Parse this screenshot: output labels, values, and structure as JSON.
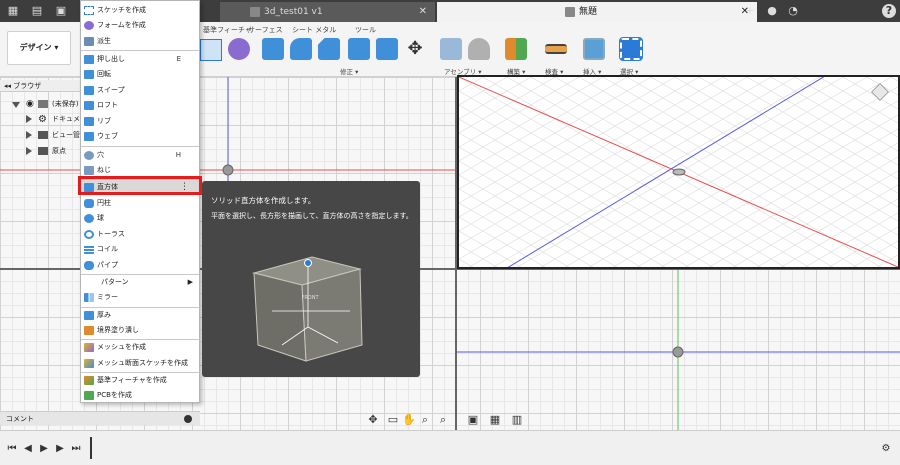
{
  "tabs": [
    {
      "label": "3d_test01 v1",
      "active": false
    },
    {
      "label": "無題",
      "active": true
    }
  ],
  "toolbar": {
    "workspace_label": "デザイン",
    "tab_labels": [
      "基準フィーチャ",
      "サーフェス",
      "シート メタル",
      "ツール"
    ],
    "group_labels": [
      "修正",
      "アセンブリ",
      "構築",
      "検査",
      "挿入",
      "選択"
    ]
  },
  "browser": {
    "title": "ブラウザ",
    "items": [
      {
        "label": "(未保存)"
      },
      {
        "label": "ドキュメント設定"
      },
      {
        "label": "ビュー管理"
      },
      {
        "label": "原点"
      }
    ]
  },
  "menu": {
    "items": [
      {
        "label": "スケッチを作成",
        "shortcut": ""
      },
      {
        "label": "フォームを作成",
        "shortcut": ""
      },
      {
        "label": "派生",
        "shortcut": ""
      },
      {
        "label": "押し出し",
        "shortcut": "E"
      },
      {
        "label": "回転",
        "shortcut": ""
      },
      {
        "label": "スイープ",
        "shortcut": ""
      },
      {
        "label": "ロフト",
        "shortcut": ""
      },
      {
        "label": "リブ",
        "shortcut": ""
      },
      {
        "label": "ウェブ",
        "shortcut": ""
      },
      {
        "label": "穴",
        "shortcut": "H"
      },
      {
        "label": "ねじ",
        "shortcut": ""
      },
      {
        "label": "直方体",
        "shortcut": ""
      },
      {
        "label": "円柱",
        "shortcut": ""
      },
      {
        "label": "球",
        "shortcut": ""
      },
      {
        "label": "トーラス",
        "shortcut": ""
      },
      {
        "label": "コイル",
        "shortcut": ""
      },
      {
        "label": "パイプ",
        "shortcut": ""
      },
      {
        "label": "パターン",
        "shortcut": ""
      },
      {
        "label": "ミラー",
        "shortcut": ""
      },
      {
        "label": "厚み",
        "shortcut": ""
      },
      {
        "label": "境界塗り潰し",
        "shortcut": ""
      },
      {
        "label": "メッシュを作成",
        "shortcut": ""
      },
      {
        "label": "メッシュ断面スケッチを作成",
        "shortcut": ""
      },
      {
        "label": "基準フィーチャを作成",
        "shortcut": ""
      },
      {
        "label": "PCBを作成",
        "shortcut": ""
      }
    ]
  },
  "tooltip": {
    "title": "ソリッド直方体を作成します。",
    "description": "平面を選択し、長方形を描画して、直方体の高さを指定します。",
    "illustration_label": "FRONT"
  },
  "comment": {
    "label": "コメント"
  },
  "colors": {
    "highlight": "#e41c1c",
    "tooltip_bg": "#474747",
    "axis_red": "#e84d4d",
    "axis_blue": "#5a5ae0",
    "axis_green": "#52c452"
  }
}
